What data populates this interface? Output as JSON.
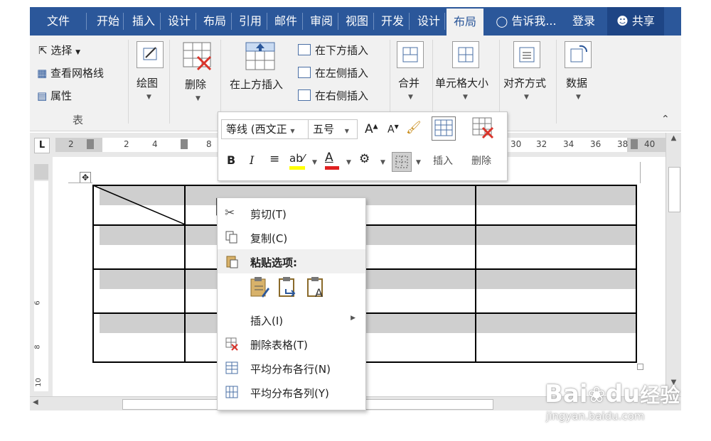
{
  "tabs": [
    {
      "label": "文件"
    },
    {
      "label": "开始"
    },
    {
      "label": "插入"
    },
    {
      "label": "设计"
    },
    {
      "label": "布局"
    },
    {
      "label": "引用"
    },
    {
      "label": "邮件"
    },
    {
      "label": "审阅"
    },
    {
      "label": "视图"
    },
    {
      "label": "开发"
    },
    {
      "label": "设计"
    },
    {
      "label": "布局"
    }
  ],
  "tell_me": "告诉我...",
  "login": "登录",
  "share": "共享",
  "ribbon": {
    "select": "选择",
    "view_gridlines": "查看网格线",
    "properties": "属性",
    "group_table": "表",
    "draw": "绘图",
    "delete": "删除",
    "insert_above": "在上方插入",
    "insert_below": "在下方插入",
    "insert_left": "在左侧插入",
    "insert_right": "在右侧插入",
    "merge": "合并",
    "cell_size": "单元格大小",
    "alignment": "对齐方式",
    "data": "数据"
  },
  "ruler": {
    "corner": "L",
    "numbers": [
      "2",
      "2",
      "4",
      "8",
      "30",
      "32",
      "34",
      "36",
      "38",
      "40"
    ],
    "vnumbers": [
      "6",
      "8",
      "10"
    ]
  },
  "mini_toolbar": {
    "font": "等线 (西文正",
    "size": "五号",
    "grow": "A",
    "shrink": "A",
    "bold": "B",
    "italic": "I",
    "font_color": "A",
    "insert": "插入",
    "delete": "删除"
  },
  "context_menu": {
    "cut": "剪切(T)",
    "copy": "复制(C)",
    "paste_options": "粘贴选项:",
    "insert": "插入(I)",
    "delete_table": "删除表格(T)",
    "distribute_rows": "平均分布各行(N)",
    "distribute_cols": "平均分布各列(Y)"
  },
  "watermark": {
    "brand": "Bai",
    "brand2": "du",
    "cn": "经验",
    "url": "jingyan.baidu.com"
  },
  "colors": {
    "accent": "#2b579a",
    "ribbon_bg": "#f1f1f1",
    "highlight_yellow": "#ffff00",
    "font_red": "#e02020"
  }
}
